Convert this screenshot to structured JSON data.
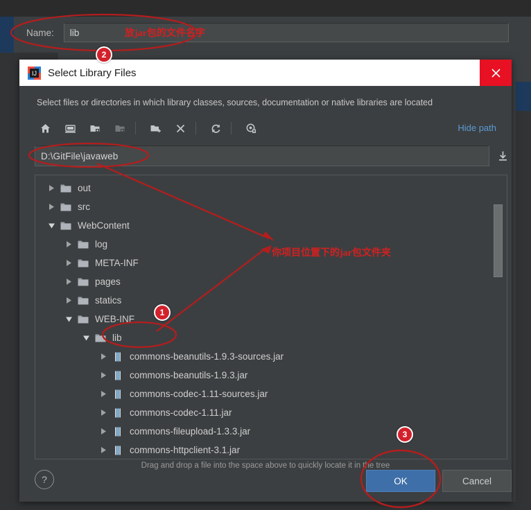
{
  "background": {
    "name_label": "Name:",
    "name_value": "lib"
  },
  "dialog": {
    "icon": "intellij-idea-icon",
    "title": "Select Library Files",
    "close_icon": "close-icon",
    "description": "Select files or directories in which library classes, sources, documentation or native libraries are located",
    "toolbar": {
      "buttons": [
        {
          "name": "home-icon",
          "tooltip": "Home",
          "enabled": true
        },
        {
          "name": "desktop-icon",
          "tooltip": "Desktop",
          "enabled": true
        },
        {
          "name": "project-folder-icon",
          "tooltip": "Project Directory",
          "enabled": true
        },
        {
          "name": "module-folder-icon",
          "tooltip": "Module Directory",
          "enabled": false
        },
        {
          "name": "new-folder-icon",
          "tooltip": "New Folder",
          "enabled": true
        },
        {
          "name": "delete-icon",
          "tooltip": "Delete",
          "enabled": true
        },
        {
          "name": "refresh-icon",
          "tooltip": "Refresh",
          "enabled": true
        },
        {
          "name": "show-hidden-icon",
          "tooltip": "Show Hidden Files",
          "enabled": true
        }
      ],
      "hide_path_label": "Hide path"
    },
    "path": {
      "value": "D:\\GitFile\\javaweb",
      "download_icon": "download-icon"
    },
    "tree": {
      "items": [
        {
          "label": "out",
          "depth": 1,
          "type": "folder",
          "state": "collapsed"
        },
        {
          "label": "src",
          "depth": 1,
          "type": "folder",
          "state": "collapsed"
        },
        {
          "label": "WebContent",
          "depth": 1,
          "type": "folder",
          "state": "expanded"
        },
        {
          "label": "log",
          "depth": 2,
          "type": "folder",
          "state": "collapsed"
        },
        {
          "label": "META-INF",
          "depth": 2,
          "type": "folder",
          "state": "collapsed"
        },
        {
          "label": "pages",
          "depth": 2,
          "type": "folder",
          "state": "collapsed"
        },
        {
          "label": "statics",
          "depth": 2,
          "type": "folder",
          "state": "collapsed"
        },
        {
          "label": "WEB-INF",
          "depth": 2,
          "type": "folder",
          "state": "expanded"
        },
        {
          "label": "lib",
          "depth": 3,
          "type": "folder",
          "state": "expanded"
        },
        {
          "label": "commons-beanutils-1.9.3-sources.jar",
          "depth": 4,
          "type": "jar",
          "state": "collapsed"
        },
        {
          "label": "commons-beanutils-1.9.3.jar",
          "depth": 4,
          "type": "jar",
          "state": "collapsed"
        },
        {
          "label": "commons-codec-1.11-sources.jar",
          "depth": 4,
          "type": "jar",
          "state": "collapsed"
        },
        {
          "label": "commons-codec-1.11.jar",
          "depth": 4,
          "type": "jar",
          "state": "collapsed"
        },
        {
          "label": "commons-fileupload-1.3.3.jar",
          "depth": 4,
          "type": "jar",
          "state": "collapsed"
        },
        {
          "label": "commons-httpclient-3.1.jar",
          "depth": 4,
          "type": "jar",
          "state": "collapsed"
        }
      ]
    },
    "hint": "Drag and drop a file into the space above to quickly locate it in the tree",
    "buttons": {
      "help_label": "?",
      "ok_label": "OK",
      "cancel_label": "Cancel"
    }
  },
  "annotations": {
    "accent_color": "#d3212c",
    "note_name_field": "放jar包的文件名字",
    "note_lib_folder": "你项目位置下的jar包文件夹",
    "badges": [
      {
        "label": "1",
        "target": "lib-tree-node"
      },
      {
        "label": "2",
        "target": "name-field"
      },
      {
        "label": "3",
        "target": "ok-button"
      }
    ]
  }
}
